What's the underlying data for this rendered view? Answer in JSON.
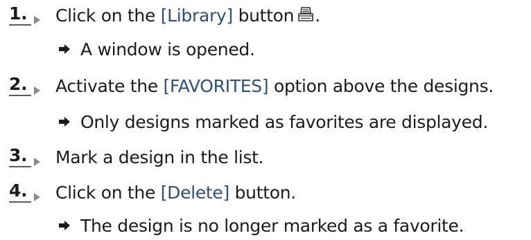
{
  "steps": [
    {
      "number": "1.",
      "before": "Click on the ",
      "ref": "[Library]",
      "after": " button",
      "icon": "library-icon",
      "tail": ".",
      "result": "A window is opened."
    },
    {
      "number": "2.",
      "before": "Activate the ",
      "ref": "[FAVORITES]",
      "after": " option above the designs.",
      "result": "Only designs marked as favorites are displayed."
    },
    {
      "number": "3.",
      "text": "Mark a design in the list."
    },
    {
      "number": "4.",
      "before": "Click on the ",
      "ref": "[Delete]",
      "after": " button.",
      "result": "The design is no longer marked as a favorite."
    }
  ],
  "colors": {
    "text": "#1b1b1b",
    "ui_reference": "#2d4f7a",
    "step_underline": "#5a5a5a",
    "step_arrow": "#8a8a8a"
  }
}
